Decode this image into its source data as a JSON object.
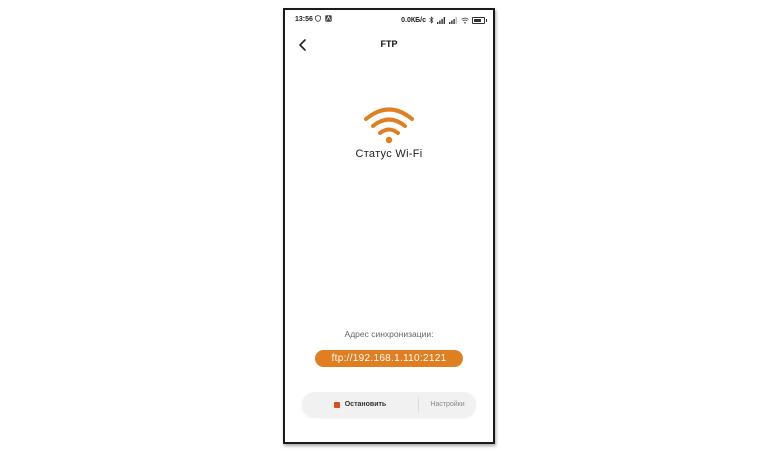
{
  "status_bar": {
    "time": "13:56",
    "speed": "0.0КБ/с"
  },
  "app_bar": {
    "title": "FTP"
  },
  "main": {
    "wifi_status_label": "Статус Wi-Fi",
    "sync_address_label": "Адрес синхронизации:",
    "sync_address": "ftp://192.168.1.110:2121"
  },
  "bottom_bar": {
    "stop_label": "Остановить",
    "settings_label": "Настройки"
  },
  "colors": {
    "accent": "#e07f21",
    "stop_icon": "#d6511c"
  },
  "icons": {
    "back": "back-arrow-icon",
    "wifi": "wifi-icon",
    "stop": "stop-icon"
  }
}
